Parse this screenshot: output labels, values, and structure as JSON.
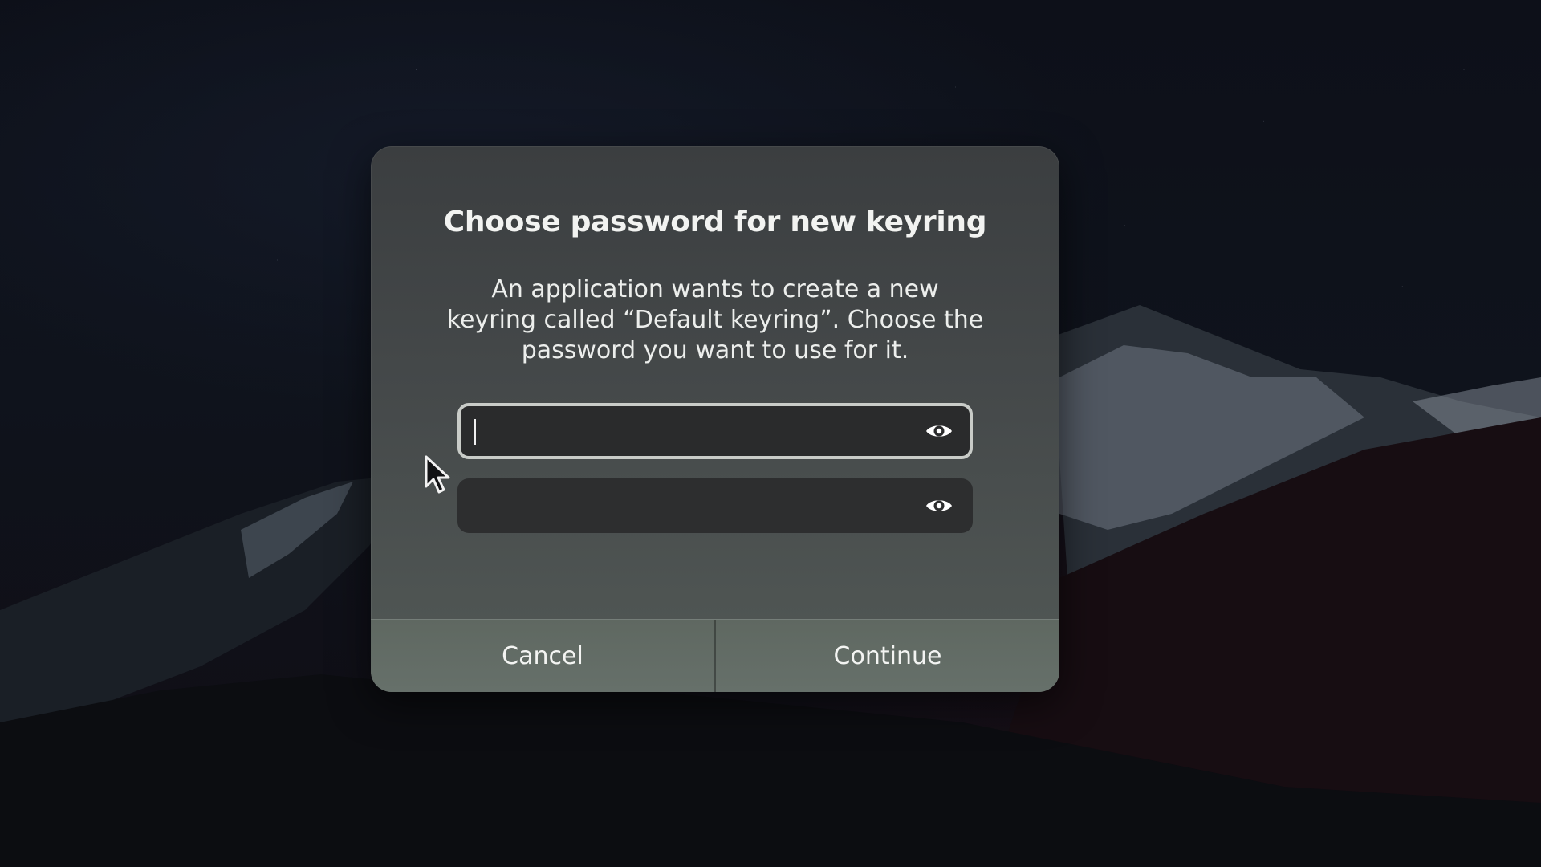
{
  "dialog": {
    "title": "Choose password for new keyring",
    "message": "An application wants to create a new keyring called “Default keyring”. Choose the password you want to use for it.",
    "password_field": {
      "value": "",
      "placeholder": "",
      "focused": true,
      "reveal_icon": "eye-icon"
    },
    "confirm_field": {
      "value": "",
      "placeholder": "",
      "focused": false,
      "reveal_icon": "eye-icon"
    },
    "cancel_label": "Cancel",
    "continue_label": "Continue"
  },
  "colors": {
    "dialog_top": "#3b3e40",
    "dialog_bottom": "#525956",
    "field_bg": "#2a2b2c",
    "focus_ring": "#c9ccc8",
    "button_bar": "#636c66",
    "text": "#f1f2f0"
  }
}
